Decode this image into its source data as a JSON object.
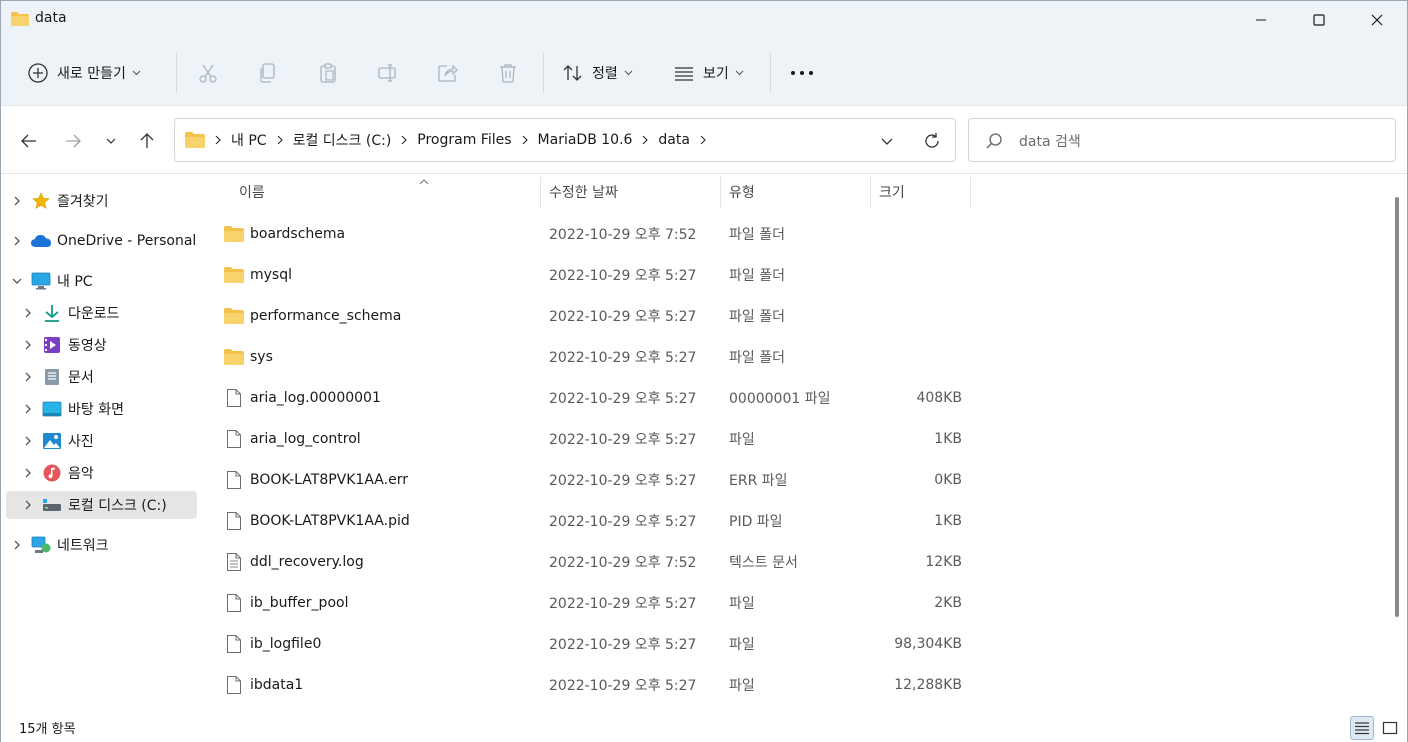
{
  "window": {
    "title": "data"
  },
  "toolbar": {
    "new_label": "새로 만들기",
    "sort_label": "정렬",
    "view_label": "보기",
    "more_label": "⋯"
  },
  "address": {
    "crumbs": [
      "내 PC",
      "로컬 디스크 (C:)",
      "Program Files",
      "MariaDB 10.6",
      "data"
    ]
  },
  "search": {
    "placeholder": "data 검색"
  },
  "sidebar": {
    "items": [
      {
        "label": "즐겨찾기",
        "icon": "star-icon"
      },
      {
        "label": "OneDrive - Personal",
        "icon": "onedrive-icon"
      },
      {
        "label": "내 PC",
        "icon": "pc-icon"
      },
      {
        "label": "다운로드",
        "icon": "download-icon"
      },
      {
        "label": "동영상",
        "icon": "video-icon"
      },
      {
        "label": "문서",
        "icon": "document-icon"
      },
      {
        "label": "바탕 화면",
        "icon": "desktop-icon"
      },
      {
        "label": "사진",
        "icon": "pictures-icon"
      },
      {
        "label": "음악",
        "icon": "music-icon"
      },
      {
        "label": "로컬 디스크 (C:)",
        "icon": "drive-icon"
      },
      {
        "label": "네트워크",
        "icon": "network-icon"
      }
    ]
  },
  "columns": {
    "name": "이름",
    "date": "수정한 날짜",
    "type": "유형",
    "size": "크기"
  },
  "files": [
    {
      "name": "boardschema",
      "date": "2022-10-29 오후 7:52",
      "type": "파일 폴더",
      "size": "",
      "kind": "folder"
    },
    {
      "name": "mysql",
      "date": "2022-10-29 오후 5:27",
      "type": "파일 폴더",
      "size": "",
      "kind": "folder"
    },
    {
      "name": "performance_schema",
      "date": "2022-10-29 오후 5:27",
      "type": "파일 폴더",
      "size": "",
      "kind": "folder"
    },
    {
      "name": "sys",
      "date": "2022-10-29 오후 5:27",
      "type": "파일 폴더",
      "size": "",
      "kind": "folder"
    },
    {
      "name": "aria_log.00000001",
      "date": "2022-10-29 오후 5:27",
      "type": "00000001 파일",
      "size": "408KB",
      "kind": "file"
    },
    {
      "name": "aria_log_control",
      "date": "2022-10-29 오후 5:27",
      "type": "파일",
      "size": "1KB",
      "kind": "file"
    },
    {
      "name": "BOOK-LAT8PVK1AA.err",
      "date": "2022-10-29 오후 5:27",
      "type": "ERR 파일",
      "size": "0KB",
      "kind": "file"
    },
    {
      "name": "BOOK-LAT8PVK1AA.pid",
      "date": "2022-10-29 오후 5:27",
      "type": "PID 파일",
      "size": "1KB",
      "kind": "file"
    },
    {
      "name": "ddl_recovery.log",
      "date": "2022-10-29 오후 7:52",
      "type": "텍스트 문서",
      "size": "12KB",
      "kind": "text"
    },
    {
      "name": "ib_buffer_pool",
      "date": "2022-10-29 오후 5:27",
      "type": "파일",
      "size": "2KB",
      "kind": "file"
    },
    {
      "name": "ib_logfile0",
      "date": "2022-10-29 오후 5:27",
      "type": "파일",
      "size": "98,304KB",
      "kind": "file"
    },
    {
      "name": "ibdata1",
      "date": "2022-10-29 오후 5:27",
      "type": "파일",
      "size": "12,288KB",
      "kind": "file"
    }
  ],
  "status": {
    "count": "15개 항목"
  },
  "colors": {
    "chrome_bg": "#eef3f8",
    "folder": "#f4c14a",
    "accent": "#0067c0"
  }
}
